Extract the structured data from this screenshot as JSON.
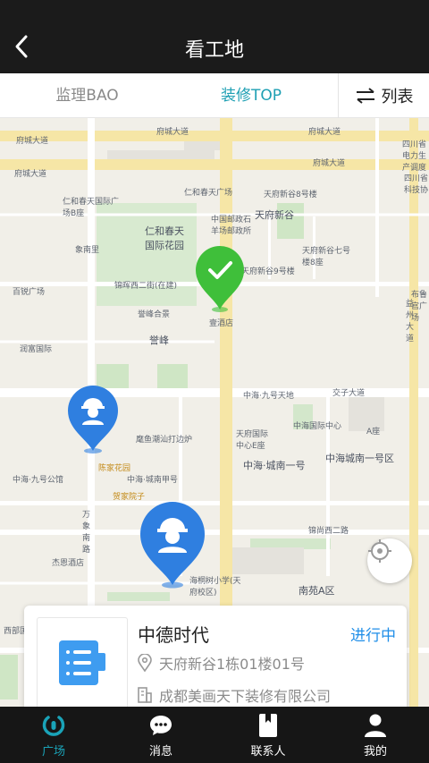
{
  "header": {
    "title": "看工地"
  },
  "tabs": [
    {
      "label": "监理BAO"
    },
    {
      "label": "装修TOP"
    }
  ],
  "list_button": {
    "label": "列表"
  },
  "map": {
    "labels": [
      {
        "text": "府城大道"
      },
      {
        "text": "府城大道"
      },
      {
        "text": "府城大道"
      },
      {
        "text": "府城大道"
      },
      {
        "text": "府城大道"
      },
      {
        "text": "仁和春天国际广场B座"
      },
      {
        "text": "仁和春天广场"
      },
      {
        "text": "天府新谷"
      },
      {
        "text": "天府新谷8号楼"
      },
      {
        "text": "仁和春天国际花园"
      },
      {
        "text": "中国邮政石羊场邮政所"
      },
      {
        "text": "天府新谷七号楼8座"
      },
      {
        "text": "天府新谷9号楼"
      },
      {
        "text": "象南里"
      },
      {
        "text": "百锐广场"
      },
      {
        "text": "锦晖西二街(在建)"
      },
      {
        "text": "誉峰"
      },
      {
        "text": "誉峰合景"
      },
      {
        "text": "壹酒店"
      },
      {
        "text": "润富国际"
      },
      {
        "text": "中海·九号天地"
      },
      {
        "text": "交子大道"
      },
      {
        "text": "中海国际中心"
      },
      {
        "text": "A座"
      },
      {
        "text": "天府国际中心E座"
      },
      {
        "text": "中海·城南一号"
      },
      {
        "text": "中海城南一号区"
      },
      {
        "text": "麾鱼潮汕打边炉"
      },
      {
        "text": "陈家花园"
      },
      {
        "text": "中海·九号公馆"
      },
      {
        "text": "中海·城南甲号"
      },
      {
        "text": "贺家院子"
      },
      {
        "text": "万象南路"
      },
      {
        "text": "锦尚西二路"
      },
      {
        "text": "杰恩酒店"
      },
      {
        "text": "海桐树小学(天府校区)"
      },
      {
        "text": "南苑A区"
      },
      {
        "text": "四川省电力生产调度"
      },
      {
        "text": "四川省科技协"
      },
      {
        "text": "益州大道"
      },
      {
        "text": "布鲁宫广场"
      },
      {
        "text": "西部国际"
      }
    ]
  },
  "card": {
    "title": "中德时代",
    "status": "进行中",
    "address": "天府新谷1栋01楼01号",
    "company": "成都美画天下装修有限公司"
  },
  "bottom_nav": [
    {
      "label": "广场"
    },
    {
      "label": "消息"
    },
    {
      "label": "联系人"
    },
    {
      "label": "我的"
    }
  ],
  "colors": {
    "header_bg": "#1b1b1b",
    "accent": "#1d9fb3",
    "status_blue": "#1f8ee8",
    "marker_green": "#3fbf3a",
    "marker_blue": "#2f7fe0"
  }
}
